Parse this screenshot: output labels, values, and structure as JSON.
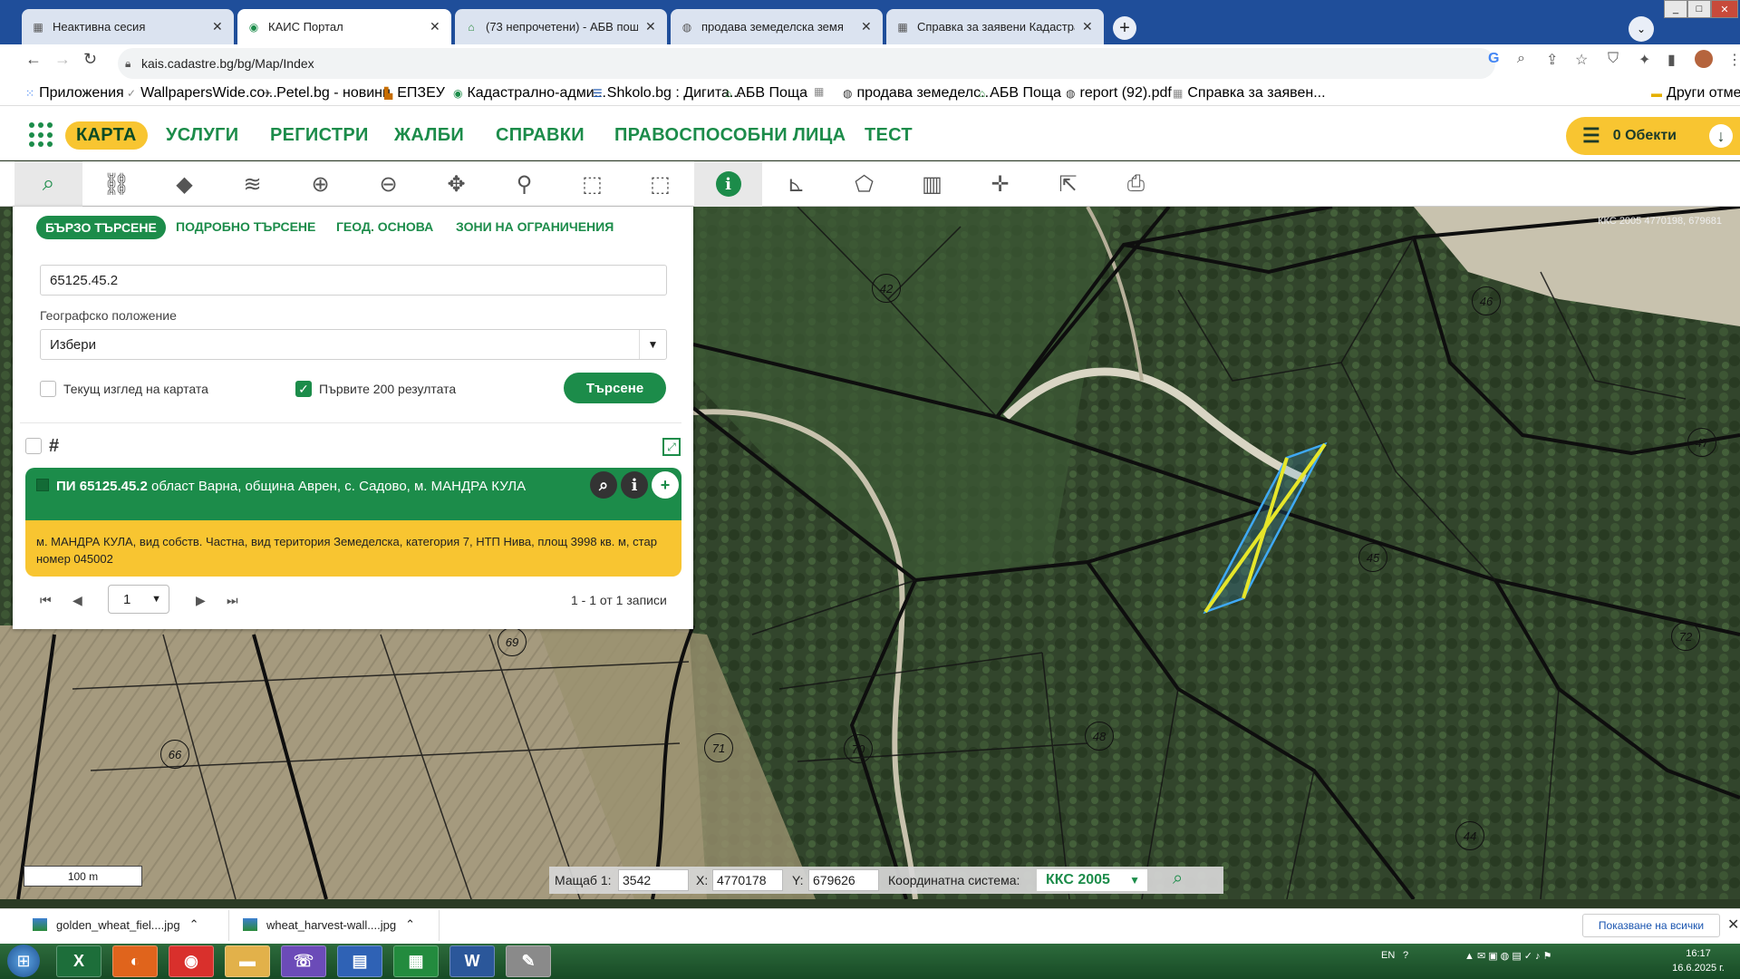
{
  "browser": {
    "tabs": [
      {
        "label": "Неактивна сесия",
        "icon": "page-icon"
      },
      {
        "label": "КАИС Портал",
        "icon": "kais-icon"
      },
      {
        "label": "(73 непрочетени) - АБВ поща",
        "icon": "abv-icon"
      },
      {
        "label": "продава земеделска земя",
        "icon": "globe-icon"
      },
      {
        "label": "Справка за заявени Кадастрал...",
        "icon": "page-icon"
      }
    ],
    "url": "kais.cadastre.bg/bg/Map/Index",
    "bookmarks": [
      "Приложения",
      "WallpapersWide.co...",
      "Petel.bg - новини",
      "ЕПЗЕУ",
      "Кадастрално-адми...",
      "Shkolo.bg : Дигита...",
      "АБВ Поща",
      "продава земеделс...",
      "АБВ Поща",
      "report (92).pdf",
      "Справка за заявен...",
      "Други отметки"
    ]
  },
  "app": {
    "nav": [
      "КАРТА",
      "УСЛУГИ",
      "РЕГИСТРИ",
      "ЖАЛБИ",
      "СПРАВКИ",
      "ПРАВОСПОСОБНИ ЛИЦА",
      "ТЕСТ"
    ],
    "objects_label": "0 Обекти",
    "toolbar": [
      "search-icon",
      "route-icon",
      "layer-icon",
      "layers-stack-icon",
      "zoom-in-icon",
      "zoom-out-icon",
      "pan-icon",
      "pin-icon",
      "select-rect-add-icon",
      "select-rect-remove-icon",
      "info-icon",
      "measure-icon",
      "polygon-icon",
      "map-icon",
      "crosshair-icon",
      "export-icon",
      "print-icon"
    ]
  },
  "search": {
    "tabs": [
      "БЪРЗО ТЪРСЕНЕ",
      "ПОДРОБНО ТЪРСЕНЕ",
      "ГЕОД. ОСНОВА",
      "ЗОНИ НА ОГРАНИЧЕНИЯ"
    ],
    "query": "65125.45.2",
    "geo_label": "Географско положение",
    "geo_value": "Избери",
    "current_view_label": "Текущ изглед на картата",
    "first200_label": "Първите 200 резултата",
    "search_button": "Търсене",
    "result": {
      "id": "ПИ 65125.45.2",
      "location": " област Варна, община Аврен, с. Садово, м. МАНДРА КУЛА",
      "details": "м. МАНДРА КУЛА, вид собств. Частна, вид територия Земеделска, категория 7, НТП Нива, площ 3998 кв. м, стар номер 045002"
    },
    "page": "1",
    "records": "1 - 1 от 1 записи"
  },
  "map": {
    "coord_readout": "ККС 2005 4770198, 679681",
    "parcel_numbers": [
      "42",
      "46",
      "47",
      "45",
      "72",
      "69",
      "66",
      "71",
      "70",
      "48",
      "44"
    ],
    "scale_bar": "100 m",
    "scale_label": "Мащаб 1:",
    "scale_value": "3542",
    "x_label": "X:",
    "x_value": "4770178",
    "y_label": "Y:",
    "y_value": "679626",
    "crs_label": "Координатна система:",
    "crs_value": "ККС 2005"
  },
  "downloads": [
    {
      "name": "golden_wheat_fiel....jpg"
    },
    {
      "name": "wheat_harvest-wall....jpg"
    }
  ],
  "downloads_show_all": "Показване на всички",
  "taskbar": {
    "lang": "EN",
    "time": "16:17",
    "date": "16.6.2025 г."
  },
  "colors": {
    "brand_green": "#1c8c4a",
    "accent_yellow": "#f8c531",
    "parcel_blue": "#3fa9f5",
    "parcel_cross": "#e6e62a"
  }
}
